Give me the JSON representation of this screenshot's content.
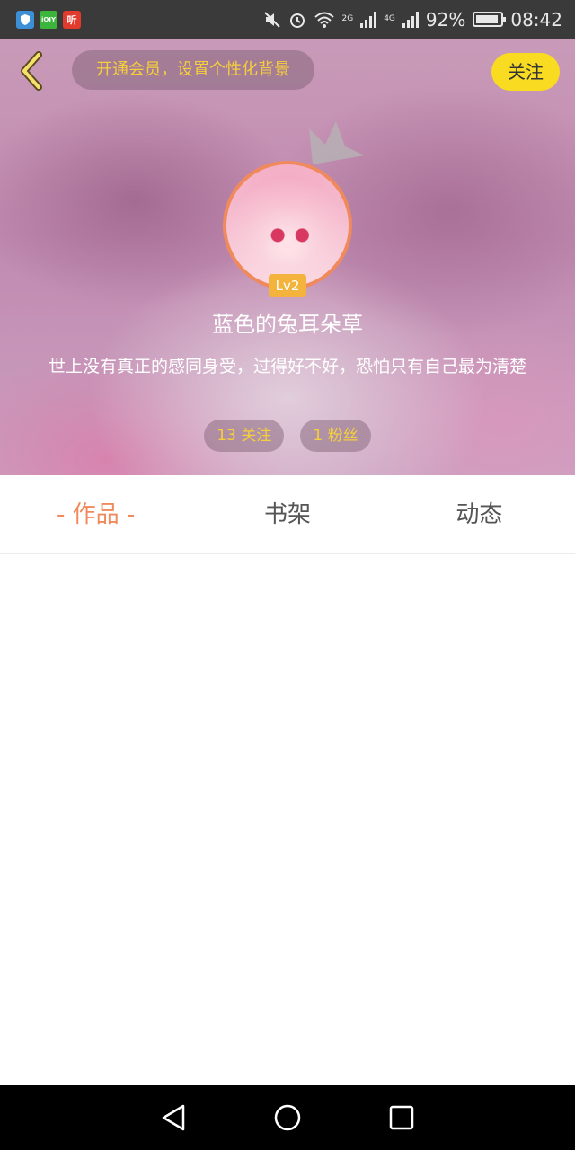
{
  "status_bar": {
    "apps": [
      "shield-app",
      "iqiyi-app",
      "ting-app"
    ],
    "iqiyi_label": "iQIY",
    "ting_label": "听",
    "network_2g": "2G",
    "network_4g": "4G",
    "battery": "92%",
    "battery_level": 0.92,
    "time": "08:42"
  },
  "header": {
    "vip_banner": "开通会员，设置个性化背景",
    "follow_label": "关注",
    "level": "Lv2",
    "username": "蓝色的兔耳朵草",
    "bio": "世上没有真正的感同身受，过得好不好，恐怕只有自己最为清楚",
    "following": "13 关注",
    "followers": "1 粉丝"
  },
  "tabs": [
    {
      "label": "- 作品 -",
      "active": true
    },
    {
      "label": "书架",
      "active": false
    },
    {
      "label": "动态",
      "active": false
    }
  ],
  "colors": {
    "accent": "#f08a5d",
    "follow_button": "#f9db21",
    "banner_text": "#f6cf3a"
  }
}
